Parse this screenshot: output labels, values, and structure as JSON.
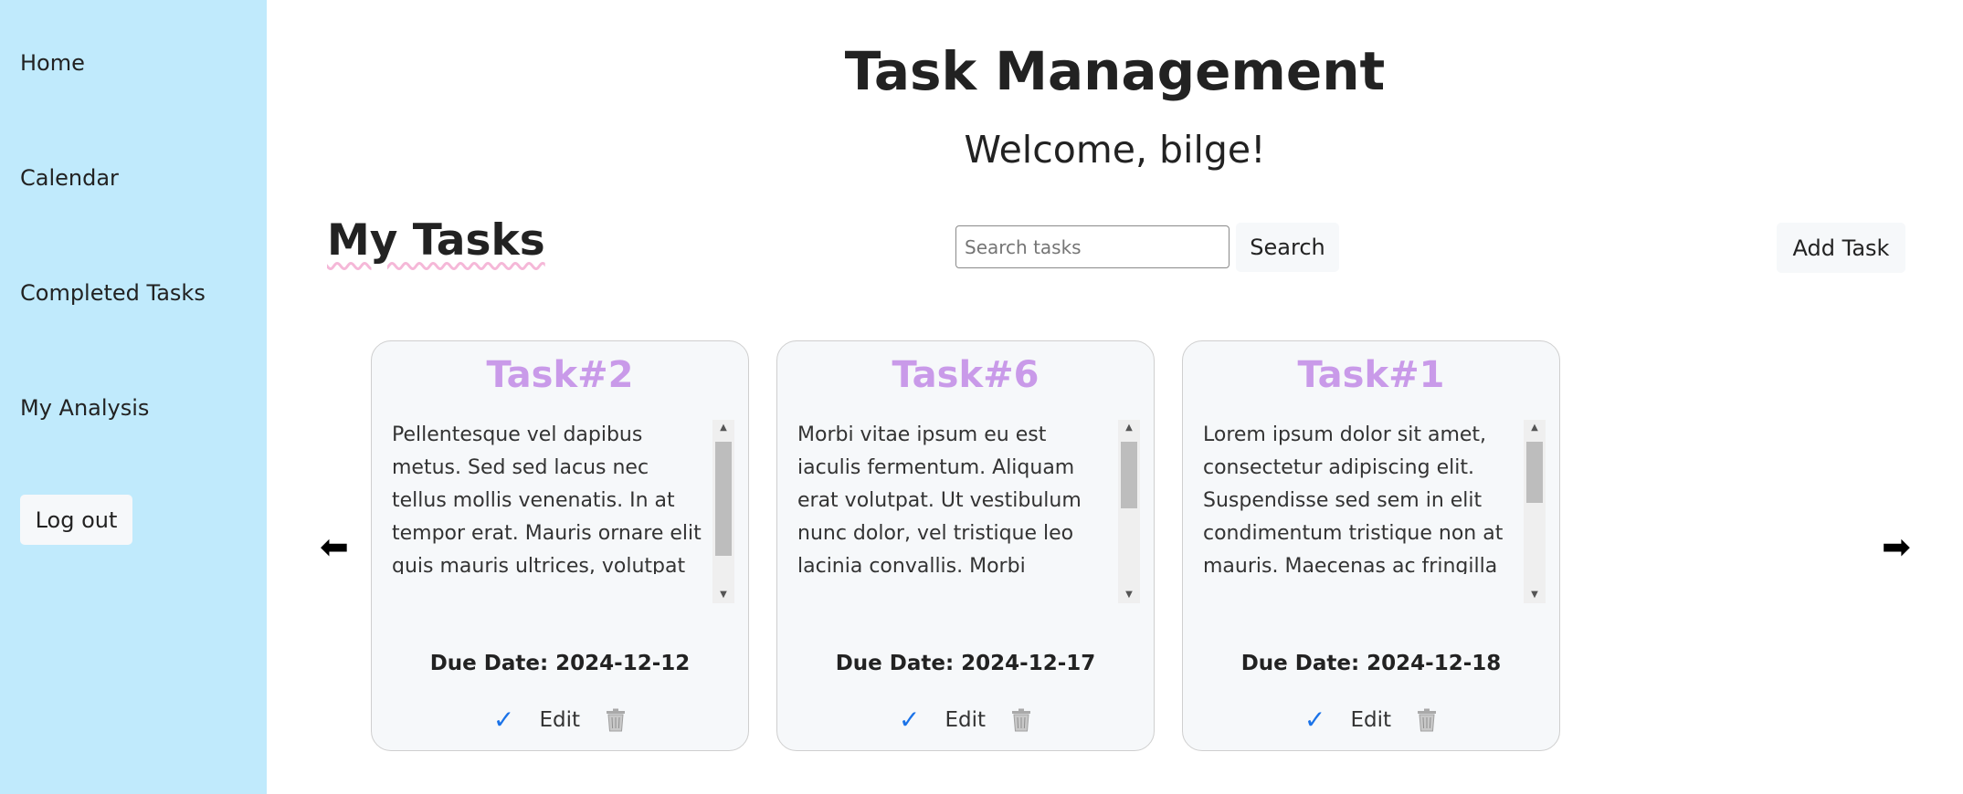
{
  "sidebar": {
    "items": [
      {
        "label": "Home"
      },
      {
        "label": "Calendar"
      },
      {
        "label": "Completed Tasks"
      },
      {
        "label": "My Analysis"
      }
    ],
    "logout_label": "Log out"
  },
  "header": {
    "title": "Task Management",
    "welcome": "Welcome, bilge!"
  },
  "toolbar": {
    "section_title": "My Tasks",
    "search_placeholder": "Search tasks",
    "search_value": "",
    "search_label": "Search",
    "add_label": "Add Task"
  },
  "carousel": {
    "prev_arrow": "⬅",
    "next_arrow": "➡"
  },
  "tasks": [
    {
      "title": "Task#2",
      "description": "Pellentesque vel dapibus metus. Sed sed lacus nec tellus mollis venenatis. In at tempor erat. Mauris ornare elit quis mauris ultrices, volutpat placerat ligula viverra.",
      "due": "Due Date: 2024-12-12",
      "complete_icon": "✓",
      "edit_label": "Edit",
      "scroll_fraction": 0.82
    },
    {
      "title": "Task#6",
      "description": "Morbi vitae ipsum eu est iaculis fermentum. Aliquam erat volutpat. Ut vestibulum nunc dolor, vel tristique leo lacinia convallis. Morbi scelerisque sapien tincidunt,",
      "due": "Due Date: 2024-12-17",
      "complete_icon": "✓",
      "edit_label": "Edit",
      "scroll_fraction": 0.48
    },
    {
      "title": "Task#1",
      "description": "Lorem ipsum dolor sit amet, consectetur adipiscing elit. Suspendisse sed sem in elit condimentum tristique non at mauris. Maecenas ac fringilla dui, vitae consectetur mi. In",
      "due": "Due Date: 2024-12-18",
      "complete_icon": "✓",
      "edit_label": "Edit",
      "scroll_fraction": 0.44
    }
  ],
  "colors": {
    "sidebar_bg": "#c0eafc",
    "task_title": "#c99ae9",
    "check": "#1b73e8"
  }
}
